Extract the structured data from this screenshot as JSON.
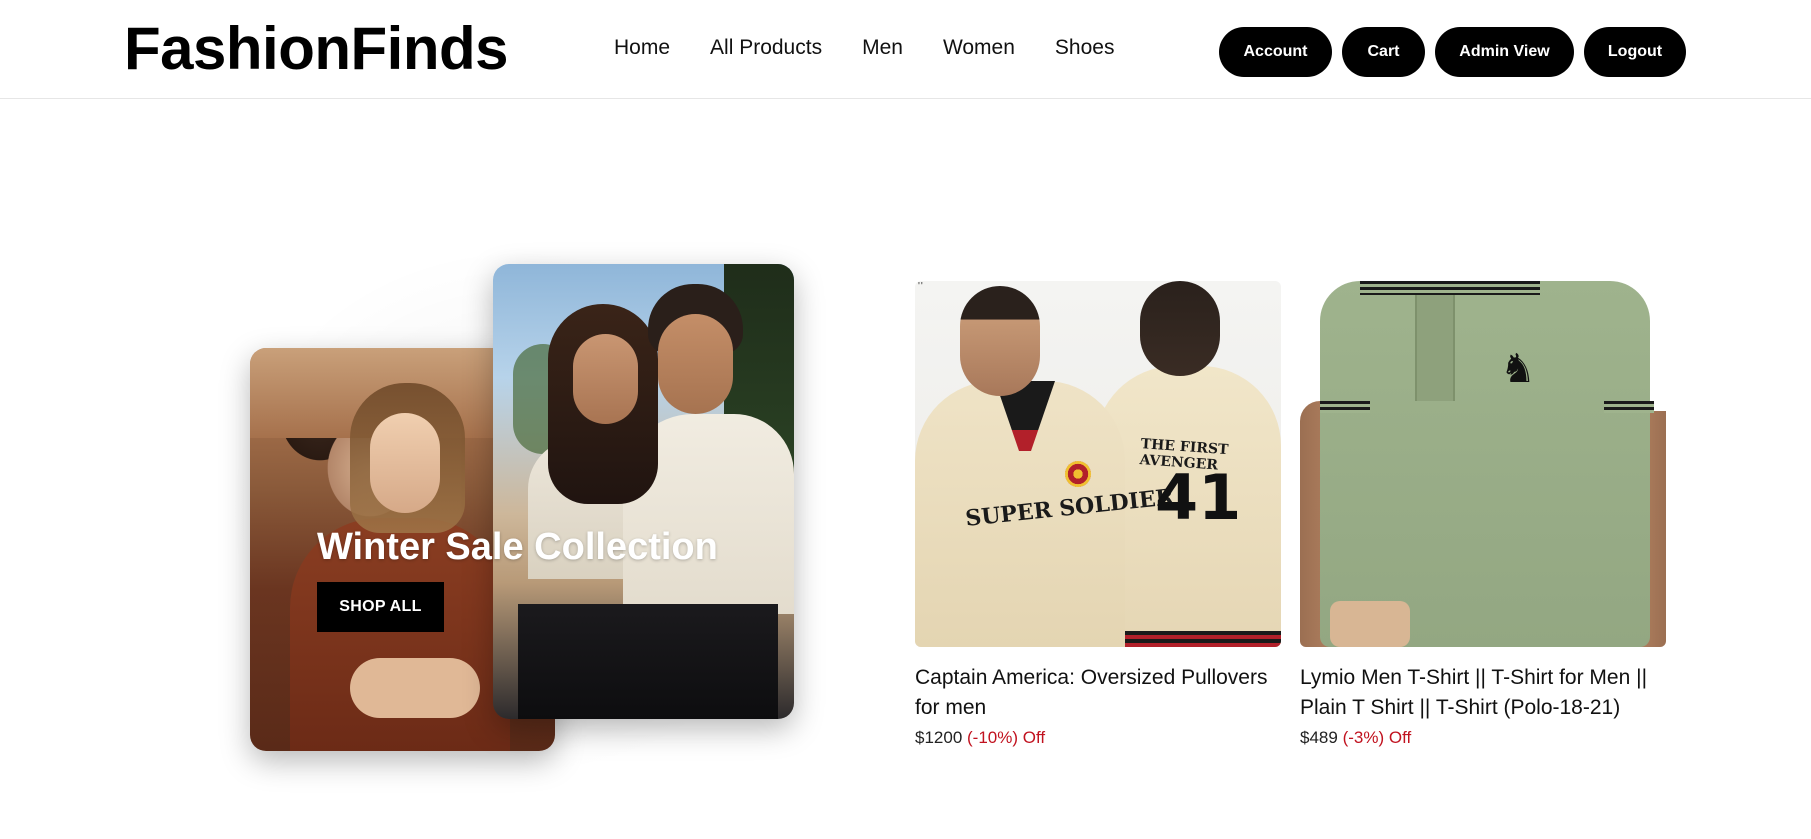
{
  "header": {
    "logo": "FashionFinds",
    "nav": [
      "Home",
      "All Products",
      "Men",
      "Women",
      "Shoes"
    ],
    "actions": {
      "account": "Account",
      "cart": "Cart",
      "admin": "Admin View",
      "logout": "Logout"
    }
  },
  "hero": {
    "title": "Winter Sale Collection",
    "cta": "SHOP ALL"
  },
  "products": [
    {
      "name": "Captain America: Oversized Pullovers for men",
      "price": "$1200",
      "discount": "(-10%) Off",
      "print_front": "SUPER SOLDIER",
      "print_back": "THE FIRST AVENGER",
      "print_number": "41"
    },
    {
      "name": "Lymio Men T-Shirt || T-Shirt for Men || Plain T Shirt || T-Shirt (Polo-18-21)",
      "price": "$489",
      "discount": "(-3%) Off"
    }
  ],
  "colors": {
    "primary": "#000000",
    "discount": "#c1121f",
    "background": "#ffffff"
  }
}
